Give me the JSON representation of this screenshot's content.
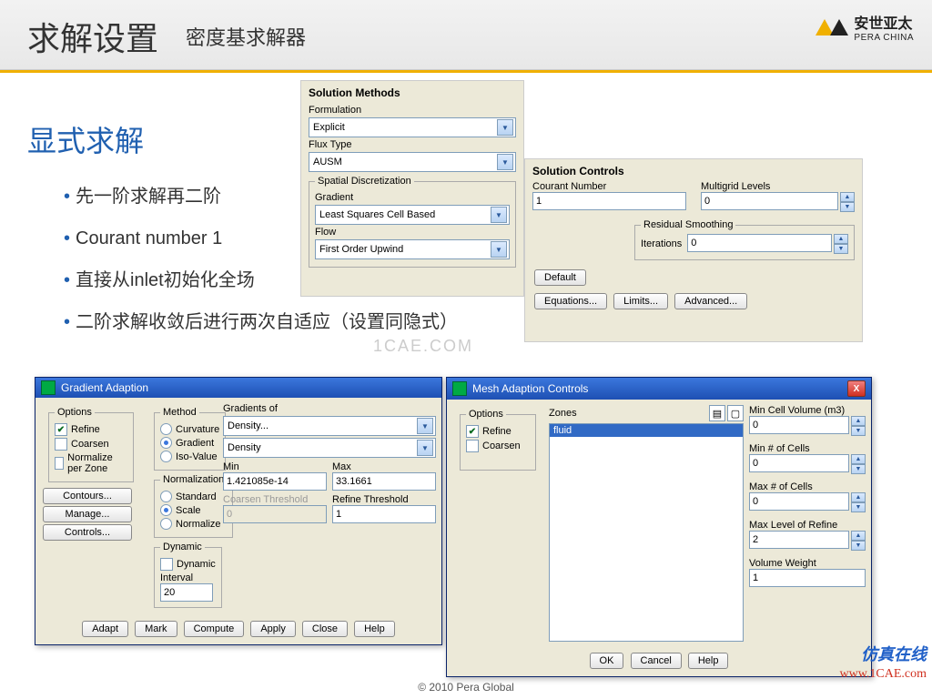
{
  "header": {
    "title": "求解设置",
    "subtitle": "密度基求解器"
  },
  "logo": {
    "cn": "安世亚太",
    "en": "PERA CHINA"
  },
  "section": {
    "title": "显式求解",
    "bullets": [
      "先一阶求解再二阶",
      "Courant number 1",
      "直接从inlet初始化全场",
      "二阶求解收敛后进行两次自适应（设置同隐式）"
    ]
  },
  "sm": {
    "title": "Solution Methods",
    "formulation_label": "Formulation",
    "formulation": "Explicit",
    "flux_label": "Flux Type",
    "flux": "AUSM",
    "spatial_legend": "Spatial Discretization",
    "gradient_label": "Gradient",
    "gradient": "Least Squares Cell Based",
    "flow_label": "Flow",
    "flow": "First Order Upwind"
  },
  "sc": {
    "title": "Solution Controls",
    "courant_label": "Courant Number",
    "courant": "1",
    "multigrid_label": "Multigrid Levels",
    "multigrid": "0",
    "rs_legend": "Residual Smoothing",
    "iter_label": "Iterations",
    "iter": "0",
    "default": "Default",
    "eq": "Equations...",
    "lim": "Limits...",
    "adv": "Advanced..."
  },
  "ga": {
    "title": "Gradient Adaption",
    "options": "Options",
    "refine": "Refine",
    "coarsen": "Coarsen",
    "norm_zone": "Normalize per Zone",
    "method": "Method",
    "curvature": "Curvature",
    "gradient": "Gradient",
    "isoval": "Iso-Value",
    "grad_of": "Gradients of",
    "grad1": "Density...",
    "grad2": "Density",
    "min_l": "Min",
    "min": "1.421085e-14",
    "max_l": "Max",
    "max": "33.1661",
    "normn": "Normalization",
    "std": "Standard",
    "scale": "Scale",
    "normalize": "Normalize",
    "ct_l": "Coarsen Threshold",
    "ct": "0",
    "rt_l": "Refine Threshold",
    "rt": "1",
    "dyn": "Dynamic",
    "dyn_chk": "Dynamic",
    "intv_l": "Interval",
    "intv": "20",
    "contours": "Contours...",
    "manage": "Manage...",
    "controls": "Controls...",
    "adapt": "Adapt",
    "mark": "Mark",
    "compute": "Compute",
    "apply": "Apply",
    "close": "Close",
    "help": "Help"
  },
  "mac": {
    "title": "Mesh Adaption Controls",
    "options": "Options",
    "refine": "Refine",
    "coarsen": "Coarsen",
    "zones": "Zones",
    "zone_item": "fluid",
    "mcv": "Min Cell Volume (m3)",
    "mcv_v": "0",
    "mnc": "Min # of Cells",
    "mnc_v": "0",
    "mxc": "Max # of Cells",
    "mxc_v": "0",
    "mlr": "Max Level of Refine",
    "mlr_v": "2",
    "vw": "Volume Weight",
    "vw_v": "1",
    "ok": "OK",
    "cancel": "Cancel",
    "help": "Help"
  },
  "footer": "© 2010 Pera Global",
  "wm": {
    "cn": "仿真在线",
    "url": "www.1CAE.com",
    "center": "1CAE.COM"
  }
}
